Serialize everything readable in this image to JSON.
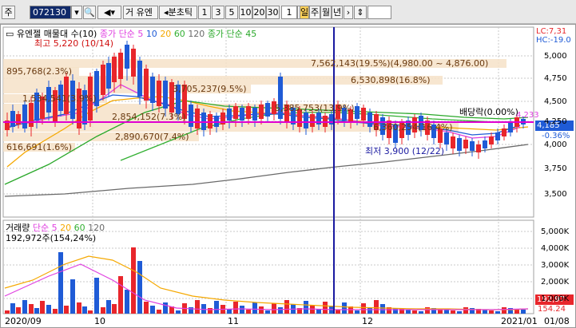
{
  "toolbar": {
    "type_label": "주",
    "code": "072130",
    "name": "거 유엔",
    "split_label": "분초틱",
    "intervals": [
      "1",
      "3",
      "5",
      "10",
      "20",
      "30"
    ],
    "count": "1",
    "period_tabs": [
      "일",
      "주",
      "월",
      "년"
    ],
    "active_period": "일"
  },
  "legend": {
    "stock": "유엔젤",
    "ma_group": "매물대 수(10)",
    "price_ma": "종가 단순",
    "ma_periods": [
      "5",
      "10",
      "20",
      "60",
      "120"
    ],
    "price_ma2": "종가 단순 45"
  },
  "price_panel": {
    "high_label": "최고 5,220 (10/14)",
    "low_label": "최저 3,900 (12/22)",
    "dividend_label": "배당락(0.00%)",
    "current": "4,185",
    "pct_right": "-0.36%",
    "mini_value": "4,233",
    "lc": "LC:7,31",
    "hc": "HC:-19.0",
    "y_ticks": [
      "5,000",
      "4,750",
      "4,500",
      "4,250",
      "4,000",
      "3,750",
      "3,500"
    ],
    "volume_profile": [
      "7,562,143(19.5%)(4,980.00 ~ 4,876.00)",
      "6,530,898(16.8%)",
      "3,705,237(9.5%)",
      "5,385,753(13.9%)",
      "2,854,152(7.3%)",
      "895,768(2.3%)",
      "1,534,541(3.9%)",
      "2,890,670(7.4%)",
      "616,691(1.6%)",
      "6,360,254(16.4%)"
    ]
  },
  "volume_panel": {
    "title": "거래량",
    "ma": "단순",
    "ma_periods": [
      "5",
      "20",
      "60",
      "120"
    ],
    "current_label": "192,972주(154,24%)",
    "last_value": "192,97",
    "last_pct": "154.24",
    "y_ticks": [
      "5,000K",
      "4,000K",
      "3,000K",
      "2,000K",
      "1,000K"
    ]
  },
  "x_axis": [
    "2020/09",
    "10",
    "11",
    "12",
    "2021/01",
    "01/08"
  ],
  "colors": {
    "up": "#e8262b",
    "down": "#1f5bd6",
    "ma5": "#e040e0",
    "ma20": "#f5a800",
    "ma60": "#33b033",
    "ma120": "#6a6a6a",
    "ma45": "#2aa82a",
    "crosshair": "#1a1aa0",
    "hline": "#e000d0"
  },
  "chart_data": {
    "type": "candlestick",
    "x": [
      "2020/09",
      "10",
      "11",
      "12",
      "2021/01",
      "01/08"
    ],
    "price_ylim": [
      3300,
      5200
    ],
    "current_price": 4185,
    "high": {
      "value": 5220,
      "date": "10/14"
    },
    "low": {
      "value": 3900,
      "date": "12/22"
    },
    "volume_ylim": [
      0,
      5500
    ]
  }
}
